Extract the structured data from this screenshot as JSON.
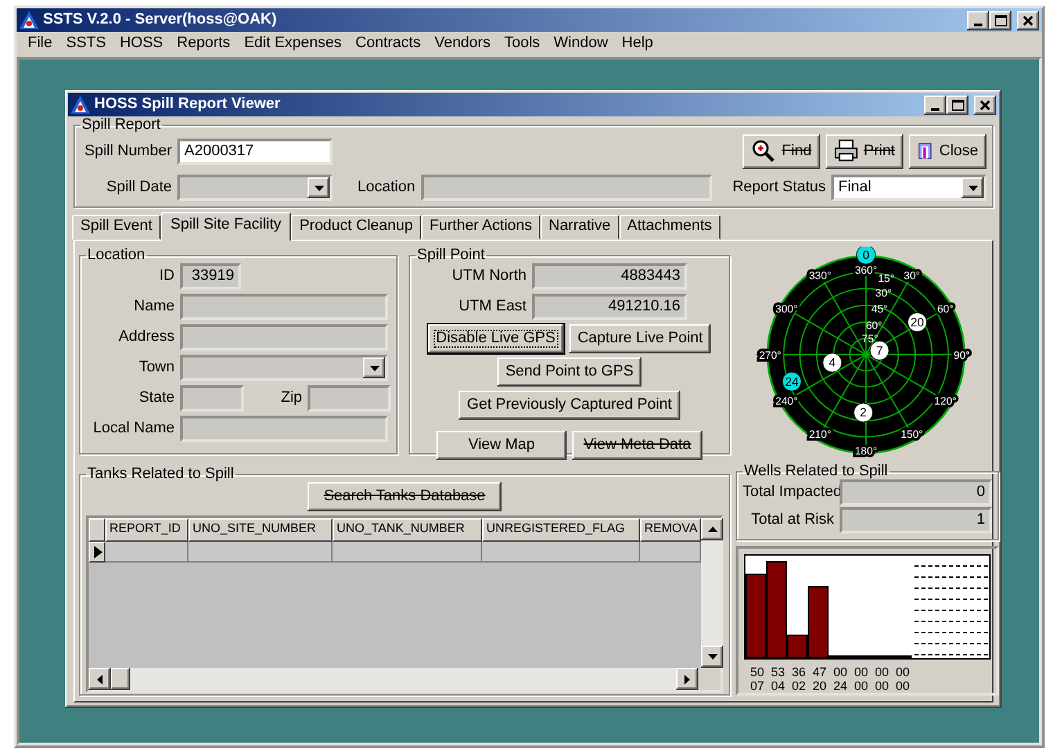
{
  "app": {
    "title": "SSTS V.2.0 - Server(hoss@OAK)"
  },
  "menu": [
    {
      "label": "File"
    },
    {
      "label": "SSTS"
    },
    {
      "label": "HOSS"
    },
    {
      "label": "Reports"
    },
    {
      "label": "Edit Expenses"
    },
    {
      "label": "Contracts"
    },
    {
      "label": "Vendors"
    },
    {
      "label": "Tools"
    },
    {
      "label": "Window"
    },
    {
      "label": "Help"
    }
  ],
  "viewer": {
    "title": "HOSS Spill Report Viewer",
    "spill_report": {
      "legend": "Spill Report",
      "spill_number": {
        "label": "Spill Number",
        "value": "A2000317"
      },
      "spill_date": {
        "label": "Spill Date"
      },
      "location": {
        "label": "Location"
      },
      "report_status": {
        "label": "Report Status",
        "value": "Final"
      },
      "buttons": [
        {
          "label": "Find",
          "kind": "find",
          "strikethrough": true
        },
        {
          "label": "Print",
          "kind": "print",
          "strikethrough": true
        },
        {
          "label": "Close",
          "kind": "close",
          "strikethrough": false
        }
      ]
    },
    "tabs": [
      {
        "label": "Spill Event",
        "selected": false
      },
      {
        "label": "Spill Site Facility",
        "selected": true
      },
      {
        "label": "Product Cleanup",
        "selected": false
      },
      {
        "label": "Further Actions",
        "selected": false
      },
      {
        "label": "Narrative",
        "selected": false
      },
      {
        "label": "Attachments",
        "selected": false
      }
    ],
    "location": {
      "legend": "Location",
      "rows": [
        {
          "fields": [
            {
              "label": "ID",
              "kind": "short",
              "value": "33919"
            }
          ]
        },
        {
          "fields": [
            {
              "label": "Name",
              "kind": "text"
            }
          ]
        },
        {
          "fields": [
            {
              "label": "Address",
              "kind": "text"
            }
          ]
        },
        {
          "fields": [
            {
              "label": "Town",
              "kind": "dropdown"
            }
          ]
        },
        {
          "fields": [
            {
              "label": "State",
              "kind": "short"
            },
            {
              "label": "Zip",
              "kind": "medium"
            }
          ]
        },
        {
          "fields": [
            {
              "label": "Local Name",
              "kind": "text"
            }
          ]
        }
      ]
    },
    "spill_point": {
      "legend": "Spill Point",
      "fields": [
        {
          "label": "UTM North",
          "value": "4883443"
        },
        {
          "label": "UTM East",
          "value": "491210.16"
        }
      ],
      "button_rows": [
        [
          {
            "label": "Disable Live GPS",
            "focused": true,
            "strikethrough": false
          },
          {
            "label": "Capture Live Point",
            "focused": false,
            "strikethrough": false
          }
        ],
        [
          {
            "label": "Send Point to GPS",
            "focused": false,
            "strikethrough": false
          }
        ],
        [
          {
            "label": "Get Previously Captured Point",
            "focused": false,
            "strikethrough": false
          }
        ],
        [
          {
            "label": "View Map",
            "focused": false,
            "strikethrough": false
          },
          {
            "label": "View Meta Data",
            "focused": false,
            "strikethrough": true
          }
        ]
      ]
    },
    "sky_plot": {
      "azimuth_labels": [
        "360°",
        "30°",
        "60°",
        "90°",
        "120°",
        "150°",
        "180°",
        "210°",
        "240°",
        "270°",
        "300°",
        "330°"
      ],
      "elevation_labels": [
        "15°",
        "30°",
        "45°",
        "60°",
        "75°"
      ],
      "satellites": [
        {
          "label": "0",
          "color": "#00e0e0"
        },
        {
          "label": "20",
          "color": "#ffffff"
        },
        {
          "label": "7",
          "color": "#ffffff"
        },
        {
          "label": "4",
          "color": "#ffffff"
        },
        {
          "label": "24",
          "color": "#00e0e0"
        },
        {
          "label": "2",
          "color": "#ffffff"
        }
      ]
    },
    "tanks": {
      "legend": "Tanks Related to Spill",
      "search_button": {
        "label": "Search Tanks Database",
        "strikethrough": true
      },
      "columns": [
        "REPORT_ID",
        "UNO_SITE_NUMBER",
        "UNO_TANK_NUMBER",
        "UNREGISTERED_FLAG",
        "REMOVA"
      ],
      "rows": [
        {
          "current": true
        }
      ]
    },
    "wells": {
      "legend": "Wells Related to Spill",
      "fields": [
        {
          "label": "Total Impacted",
          "value": "0"
        },
        {
          "label": "Total at Risk",
          "value": "1"
        }
      ]
    },
    "signal": {
      "channels": [
        {
          "level": 0.88,
          "strength": "50",
          "satellite": "07"
        },
        {
          "level": 1,
          "strength": "53",
          "satellite": "04"
        },
        {
          "level": 0.24,
          "strength": "36",
          "satellite": "02"
        },
        {
          "level": 0.75,
          "strength": "47",
          "satellite": "20"
        },
        {
          "level": 0,
          "strength": "00",
          "satellite": "24"
        },
        {
          "level": 0,
          "strength": "00",
          "satellite": "00"
        },
        {
          "level": 0,
          "strength": "00",
          "satellite": "00"
        },
        {
          "level": 0,
          "strength": "00",
          "satellite": "00"
        }
      ]
    }
  }
}
